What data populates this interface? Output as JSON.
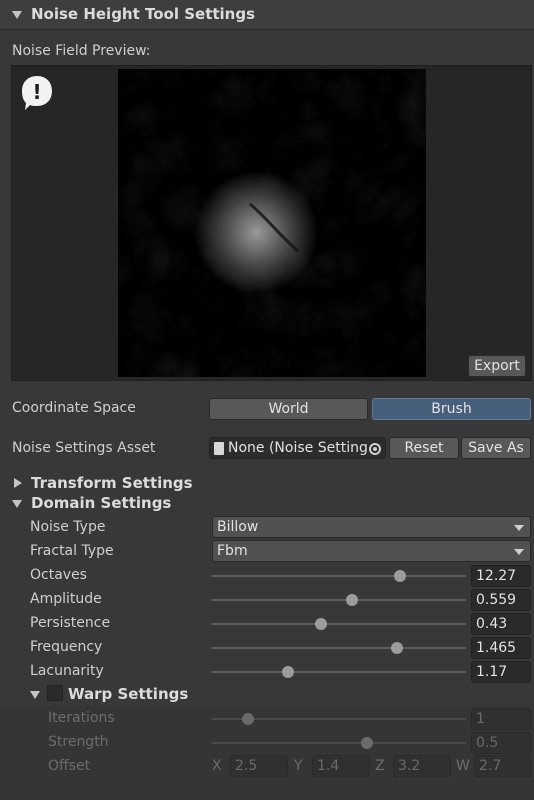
{
  "header": {
    "title": "Noise Height Tool Settings"
  },
  "preview": {
    "label": "Noise Field Preview:",
    "export_label": "Export",
    "warning_glyph": "!"
  },
  "coordinate_space": {
    "label": "Coordinate Space",
    "options": [
      "World",
      "Brush"
    ],
    "selected": "Brush"
  },
  "noise_asset": {
    "label": "Noise Settings Asset",
    "value": "None (Noise Setting",
    "reset_label": "Reset",
    "save_as_label": "Save As"
  },
  "sections": {
    "transform": "Transform Settings",
    "domain": "Domain Settings",
    "warp": "Warp Settings"
  },
  "domain": {
    "noise_type": {
      "label": "Noise Type",
      "value": "Billow"
    },
    "fractal_type": {
      "label": "Fractal Type",
      "value": "Fbm"
    },
    "sliders": [
      {
        "label": "Octaves",
        "value": "12.27",
        "fraction": 0.74
      },
      {
        "label": "Amplitude",
        "value": "0.559",
        "fraction": 0.55
      },
      {
        "label": "Persistence",
        "value": "0.43",
        "fraction": 0.43
      },
      {
        "label": "Frequency",
        "value": "1.465",
        "fraction": 0.73
      },
      {
        "label": "Lacunarity",
        "value": "1.17",
        "fraction": 0.3
      }
    ]
  },
  "warp": {
    "enabled": false,
    "sliders": [
      {
        "label": "Iterations",
        "value": "1",
        "fraction": 0.14
      },
      {
        "label": "Strength",
        "value": "0.5",
        "fraction": 0.61
      }
    ],
    "offset": {
      "label": "Offset",
      "x_label": "X",
      "x": "2.5",
      "y_label": "Y",
      "y": "1.4",
      "z_label": "Z",
      "z": "3.2",
      "w_label": "W",
      "w": "2.7"
    }
  },
  "colors": {
    "background": "#383838",
    "accent": "#46607c"
  },
  "icons": [
    "collapse-triangle-icon",
    "warning-speech-bubble-icon",
    "script-asset-icon",
    "object-picker-icon",
    "dropdown-arrow-icon"
  ]
}
